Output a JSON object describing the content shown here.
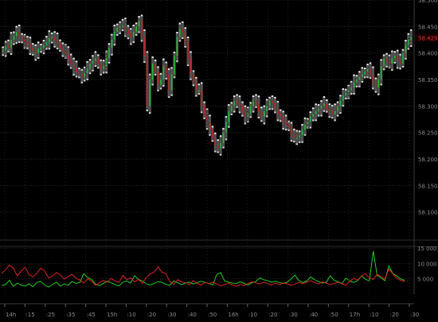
{
  "chart_data": [
    {
      "type": "candlestick",
      "grid": true,
      "ylim": [
        58.05,
        58.5
      ],
      "y_ticks": [
        "58.500",
        "58.450",
        "58.400",
        "58.350",
        "58.300",
        "58.250",
        "58.200",
        "58.150",
        "58.100"
      ],
      "last_price": "58.429",
      "x_ticks": [
        "14h",
        ":15",
        ":25",
        ":35",
        ":45",
        "15h",
        ":10",
        ":20",
        ":30",
        ":40",
        ":50",
        "16h",
        ":10",
        ":20",
        ":30",
        ":40",
        ":50",
        "17h",
        ":10",
        ":20",
        ":30"
      ],
      "closes": [
        58.405,
        58.413,
        58.41,
        58.425,
        58.432,
        58.44,
        58.43,
        58.426,
        58.42,
        58.416,
        58.41,
        58.405,
        58.4,
        58.408,
        58.41,
        58.415,
        58.42,
        58.428,
        58.43,
        58.425,
        58.418,
        58.41,
        58.405,
        58.398,
        58.39,
        58.38,
        58.372,
        58.365,
        58.36,
        58.355,
        58.362,
        58.37,
        58.38,
        58.385,
        58.39,
        58.378,
        58.37,
        58.375,
        58.39,
        58.41,
        58.425,
        58.44,
        58.448,
        58.45,
        58.452,
        58.444,
        58.436,
        58.43,
        58.44,
        58.45,
        58.46,
        58.43,
        58.395,
        58.3,
        58.35,
        58.38,
        58.365,
        58.34,
        58.35,
        58.375,
        58.36,
        58.33,
        58.36,
        58.395,
        58.43,
        58.445,
        58.44,
        58.42,
        58.39,
        58.36,
        58.345,
        58.33,
        58.33,
        58.3,
        58.285,
        58.27,
        58.255,
        58.24,
        58.225,
        58.22,
        58.23,
        58.25,
        58.27,
        58.29,
        58.3,
        58.31,
        58.305,
        58.3,
        58.29,
        58.28,
        58.285,
        58.3,
        58.31,
        58.305,
        58.29,
        58.28,
        58.29,
        58.3,
        58.31,
        58.305,
        58.295,
        58.285,
        58.28,
        58.27,
        58.265,
        58.26,
        58.245,
        58.24,
        58.24,
        58.245,
        58.255,
        58.265,
        58.27,
        58.28,
        58.285,
        58.29,
        58.295,
        58.3,
        58.305,
        58.295,
        58.29,
        58.285,
        58.29,
        58.3,
        58.31,
        58.32,
        58.325,
        58.33,
        58.335,
        58.345,
        58.35,
        58.355,
        58.36,
        58.365,
        58.37,
        58.36,
        58.345,
        58.335,
        58.35,
        58.375,
        58.39,
        58.385,
        58.38,
        58.39,
        58.395,
        58.385,
        58.38,
        58.4,
        58.415,
        58.425,
        58.43
      ]
    },
    {
      "type": "line",
      "grid": true,
      "ylim": [
        0,
        15000
      ],
      "y_ticks": [
        "15 000",
        "10 000",
        "5 000"
      ],
      "series": [
        {
          "color": "#22cc22",
          "values": [
            2800,
            3100,
            4500,
            2500,
            3600,
            3000,
            2600,
            3400,
            2400,
            3800,
            4200,
            3000,
            2300,
            3100,
            3900,
            2600,
            3300,
            2900,
            4100,
            3500,
            3800,
            6700,
            5400,
            4800,
            3300,
            2800,
            3500,
            4200,
            3700,
            3100,
            2700,
            3900,
            4300,
            3600,
            6000,
            4800,
            4300,
            3400,
            3000,
            3500,
            4100,
            3800,
            3200,
            2900,
            4300,
            3700,
            3100,
            3600,
            3900,
            3300,
            3800,
            4200,
            3800,
            3500,
            3000,
            6400,
            7000,
            4300,
            3900,
            3600,
            3500,
            4000,
            3500,
            3000,
            3700,
            4100,
            5300,
            4700,
            4400,
            3900,
            4200,
            3800,
            3500,
            3900,
            5000,
            6200,
            4400,
            3800,
            4300,
            5600,
            4700,
            4100,
            3600,
            3900,
            6000,
            4500,
            4000,
            3500,
            5200,
            4300,
            3800,
            4400,
            5900,
            4900,
            4300,
            14000,
            6100,
            5300,
            4400,
            9200,
            6700,
            5900,
            5000,
            4500
          ]
        },
        {
          "color": "#dd2222",
          "values": [
            6800,
            7900,
            9500,
            8500,
            6000,
            7500,
            8800,
            6400,
            5600,
            6900,
            8400,
            7600,
            5300,
            5900,
            7000,
            6300,
            4900,
            5700,
            6500,
            5200,
            4600,
            3600,
            5000,
            4200,
            2900,
            3700,
            4500,
            3900,
            5100,
            4300,
            3800,
            6100,
            4700,
            5300,
            4000,
            4800,
            3500,
            5500,
            6600,
            7200,
            8900,
            7100,
            6700,
            4200,
            3200,
            4700,
            4000,
            3700,
            3100,
            4400,
            3500,
            3000,
            3800,
            3400,
            3900,
            3300,
            2700,
            3100,
            3600,
            3000,
            2600,
            3200,
            2800,
            3500,
            4000,
            3700,
            3300,
            3900,
            3500,
            3000,
            3600,
            3100,
            3700,
            3400,
            2900,
            3300,
            3800,
            3400,
            3900,
            4400,
            3800,
            3300,
            4000,
            3600,
            3100,
            3500,
            3900,
            3400,
            2900,
            4200,
            5100,
            4600,
            5900,
            6700,
            5300,
            4800,
            6500,
            5700,
            4900,
            8200,
            6600,
            5200,
            4500,
            4100
          ]
        }
      ]
    }
  ]
}
